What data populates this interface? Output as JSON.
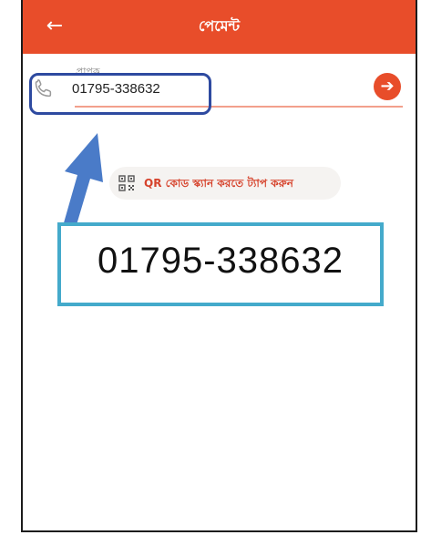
{
  "header": {
    "title": "পেমেন্ট",
    "back_icon": "arrow-left-icon"
  },
  "recipient": {
    "label": "প্রাপক",
    "value": "01795-338632",
    "leading_icon": "phone-icon",
    "submit_icon": "arrow-right-icon"
  },
  "qr": {
    "label": "QR কোড স্ক্যান করতে ট্যাপ করুন",
    "icon": "qr-code-icon"
  },
  "callout": {
    "text": "01795-338632"
  },
  "colors": {
    "brand": "#e84d2a",
    "highlight_box": "#2e4aa0",
    "callout_border": "#44aacb",
    "arrow": "#4a7bc8"
  }
}
